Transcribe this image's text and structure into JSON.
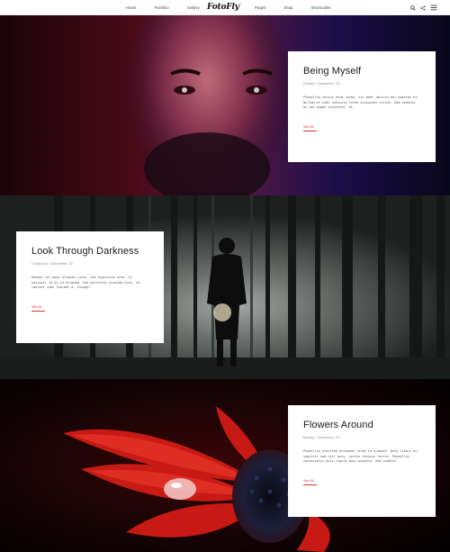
{
  "nav": {
    "left": [
      "Home",
      "Portfolio",
      "Gallery"
    ],
    "right": [
      "Pages",
      "Shop",
      "Shortcodes"
    ]
  },
  "brand": {
    "logo": "FotoFly",
    "mark": "™"
  },
  "icons": {
    "search": "search-icon",
    "share": "share-icon",
    "menu": "menu-icon"
  },
  "posts": [
    {
      "title": "Being Myself",
      "meta": "People / December, 22",
      "excerpt": "Phasellus varius enim lorem, sit amet iaculis dui egestas et. Nullam et nibh vehicula lorem vulputate cursus. Sed sodales mi non augue vulputate, et.",
      "link": "See All"
    },
    {
      "title": "Look Through Darkness",
      "meta": "Childhood / December, 22",
      "excerpt": "Aenean sit amet aliquam justo, sed dignissim urna. Cu suscipit id ex id aliquam. Sed porttitor gravida nisi, id laoreet nibh laoreet a. Integer",
      "link": "See All"
    },
    {
      "title": "Flowers Around",
      "meta": "Beauty / December, 22",
      "excerpt": "Phasellus eleifend accumsan lorem id aliquet. Duis libero ex, sagittis sed nisl quis, varius rhoncus lectus. Phasellus consectetur quis ligula quis posuere. Sed sodales",
      "link": "See All"
    }
  ],
  "colors": {
    "accent": "#dd3333"
  }
}
